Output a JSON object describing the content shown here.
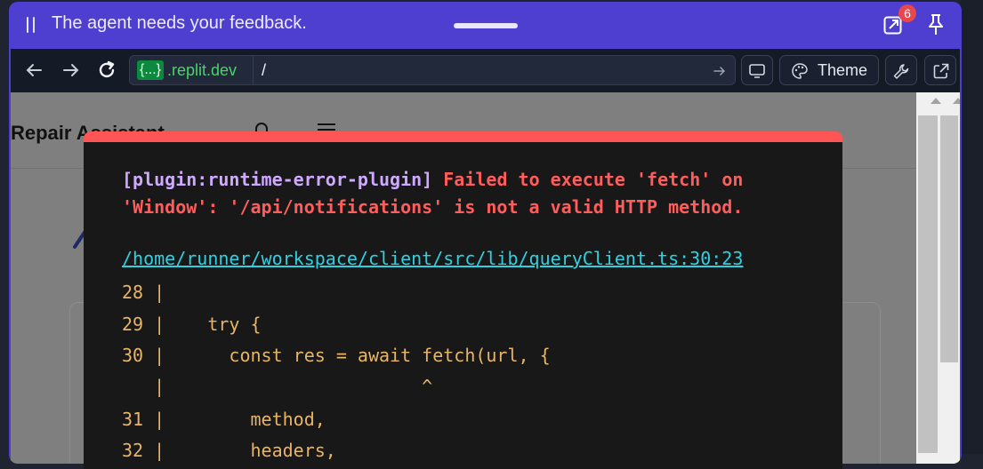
{
  "agent_bar": {
    "message": "The agent needs your feedback.",
    "icons": [
      "pause-icon",
      "popout-icon",
      "pin-icon"
    ]
  },
  "toolbar": {
    "url_braces": "{...}",
    "url_domain": ".replit.dev",
    "url_path": "/",
    "theme_label": "Theme",
    "devtools_badge": "6",
    "icons": [
      "back-arrow-icon",
      "forward-arrow-icon",
      "refresh-icon",
      "go-arrow-icon",
      "monitor-icon",
      "palette-icon",
      "wrench-icon",
      "external-link-icon"
    ]
  },
  "preview": {
    "app_title": "Repair Assistant"
  },
  "error_overlay": {
    "plugin": "[plugin:runtime-error-plugin]",
    "message_line1": "Failed to execute 'fetch' on",
    "message_line2": "'Window': '/api/notifications' is not a valid HTTP method.",
    "file_link": "/home/runner/workspace/client/src/lib/queryClient.ts:30:23",
    "code_lines": [
      "28 |",
      "29 |    try {",
      "30 |      const res = await fetch(url, {",
      "   |                        ^",
      "31 |        method,",
      "32 |        headers,"
    ]
  },
  "colors": {
    "frame_accent": "#4f3fd0",
    "error_red": "#ff5555",
    "link_cyan": "#2fd1e0",
    "code_orange": "#e8b566",
    "plugin_purple": "#cfa9ff",
    "domain_green": "#49d468"
  }
}
